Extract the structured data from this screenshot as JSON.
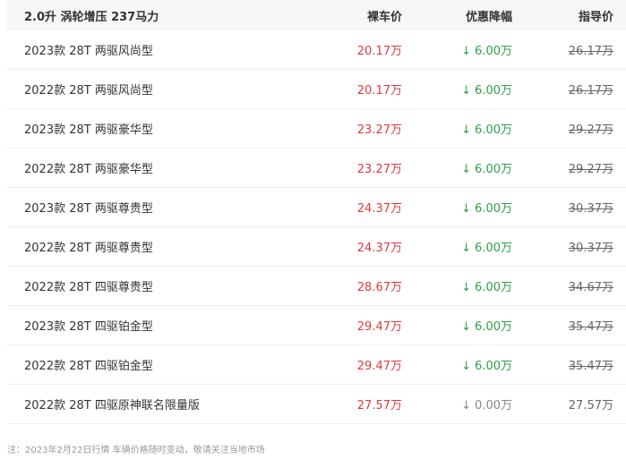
{
  "header": {
    "engine": "2.0升 涡轮增压 237马力",
    "price_col": "裸车价",
    "discount_col": "优惠降幅",
    "guide_col": "指导价"
  },
  "rows": [
    {
      "name": "2023款 28T 两驱风尚型",
      "price": "20.17万",
      "discount": "6.00万",
      "guide": "26.17万",
      "guide_strike": true,
      "discount_down": true
    },
    {
      "name": "2022款 28T 两驱风尚型",
      "price": "20.17万",
      "discount": "6.00万",
      "guide": "26.17万",
      "guide_strike": true,
      "discount_down": true
    },
    {
      "name": "2023款 28T 两驱豪华型",
      "price": "23.27万",
      "discount": "6.00万",
      "guide": "29.27万",
      "guide_strike": true,
      "discount_down": true
    },
    {
      "name": "2022款 28T 两驱豪华型",
      "price": "23.27万",
      "discount": "6.00万",
      "guide": "29.27万",
      "guide_strike": true,
      "discount_down": true
    },
    {
      "name": "2023款 28T 两驱尊贵型",
      "price": "24.37万",
      "discount": "6.00万",
      "guide": "30.37万",
      "guide_strike": true,
      "discount_down": true
    },
    {
      "name": "2022款 28T 两驱尊贵型",
      "price": "24.37万",
      "discount": "6.00万",
      "guide": "30.37万",
      "guide_strike": true,
      "discount_down": true
    },
    {
      "name": "2022款 28T 四驱尊贵型",
      "price": "28.67万",
      "discount": "6.00万",
      "guide": "34.67万",
      "guide_strike": true,
      "discount_down": true
    },
    {
      "name": "2023款 28T 四驱铂金型",
      "price": "29.47万",
      "discount": "6.00万",
      "guide": "35.47万",
      "guide_strike": true,
      "discount_down": true
    },
    {
      "name": "2022款 28T 四驱铂金型",
      "price": "29.47万",
      "discount": "6.00万",
      "guide": "35.47万",
      "guide_strike": true,
      "discount_down": true
    },
    {
      "name": "2022款 28T 四驱原神联名限量版",
      "price": "27.57万",
      "discount": "0.00万",
      "guide": "27.57万",
      "guide_strike": false,
      "discount_down": false
    }
  ],
  "arrow_glyph": "↓",
  "colors": {
    "price": "#e0393e",
    "discount_active": "#2aa049",
    "discount_none": "#888888",
    "header_bg": "#f6f6f6"
  },
  "footnote": "注：2023年2月22日行情 车辆价格随时变动，敬请关注当地市场"
}
